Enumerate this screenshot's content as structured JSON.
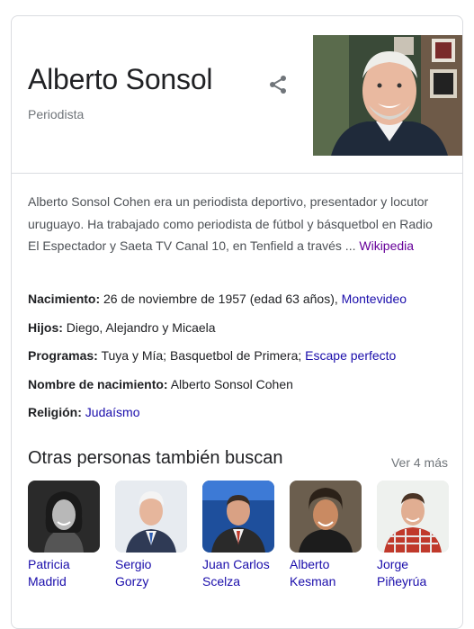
{
  "entity": {
    "name": "Alberto Sonsol",
    "subtitle": "Periodista"
  },
  "description": {
    "text": "Alberto Sonsol Cohen era un periodista deportivo, presentador y locutor uruguayo. Ha trabajado como periodista de fútbol y básquetbol en Radio El Espectador y Saeta TV Canal 10, en Tenfield a través ...",
    "source_link": "Wikipedia"
  },
  "facts": {
    "birth": {
      "label": "Nacimiento:",
      "value": "26 de noviembre de 1957 (edad 63 años),",
      "link": "Montevideo"
    },
    "children": {
      "label": "Hijos:",
      "value": "Diego, Alejandro y Micaela"
    },
    "programs": {
      "label": "Programas:",
      "value": "Tuya y Mía; Basquetbol de Primera;",
      "link": "Escape perfecto"
    },
    "birth_name": {
      "label": "Nombre de nacimiento:",
      "value": "Alberto Sonsol Cohen"
    },
    "religion": {
      "label": "Religión:",
      "link": "Judaísmo"
    }
  },
  "others": {
    "title": "Otras personas también buscan",
    "more": "Ver 4 más",
    "people": [
      {
        "name": "Patricia Madrid"
      },
      {
        "name": "Sergio Gorzy"
      },
      {
        "name": "Juan Carlos Scelza"
      },
      {
        "name": "Alberto Kesman"
      },
      {
        "name": "Jorge Piñeyrúa"
      }
    ]
  },
  "colors": {
    "link": "#1a0dab",
    "visited_link": "#660099",
    "muted": "#70757a",
    "border": "#dadce0"
  }
}
